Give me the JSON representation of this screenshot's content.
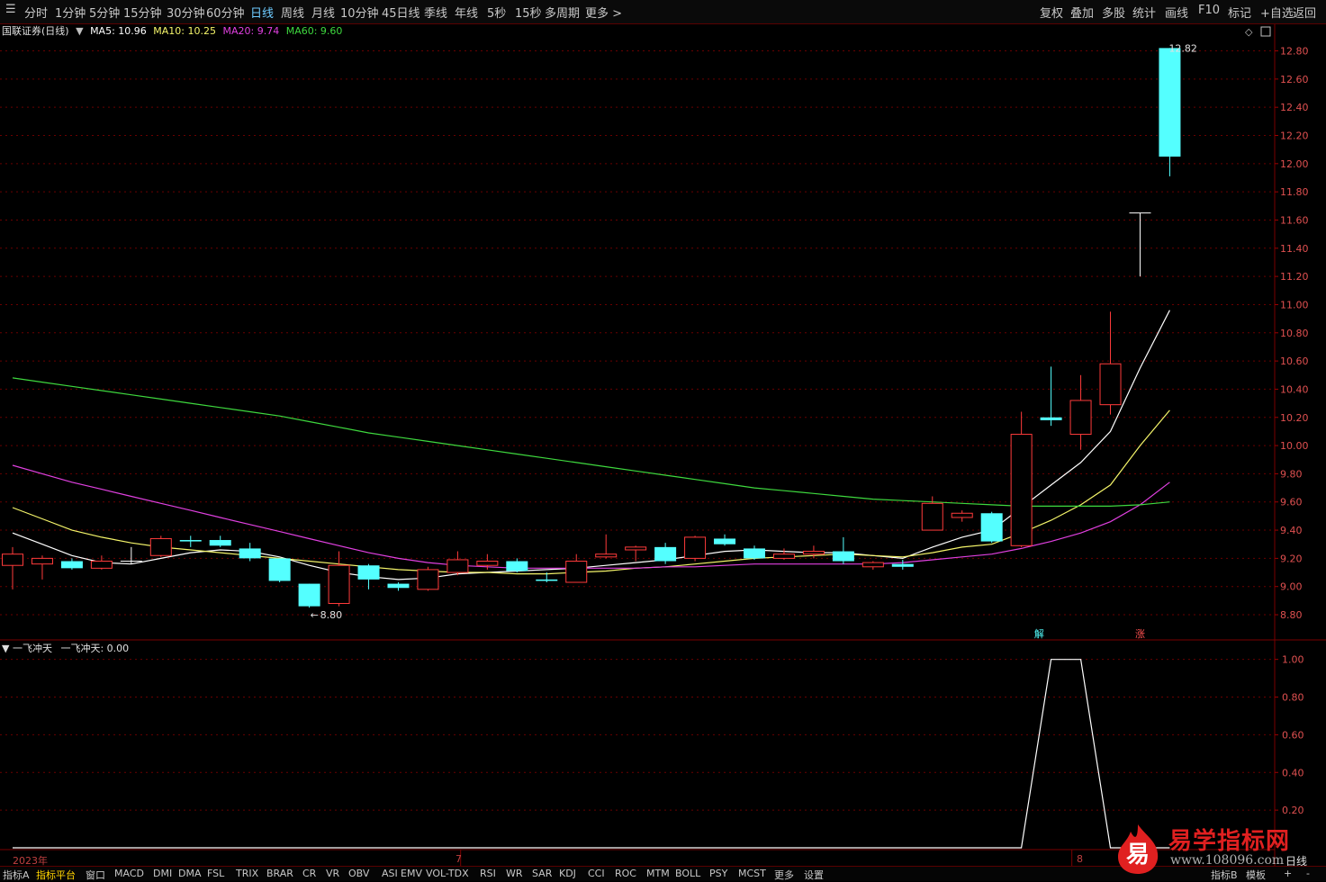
{
  "toolbar": {
    "left_items": [
      "分时",
      "1分钟",
      "5分钟",
      "15分钟",
      "30分钟",
      "60分钟",
      "日线",
      "周线",
      "月线",
      "10分钟",
      "45日线",
      "季线",
      "年线",
      "5秒",
      "15秒",
      "多周期",
      "更多 >"
    ],
    "active": "日线",
    "right_items": [
      "复权",
      "叠加",
      "多股",
      "统计",
      "画线",
      "F10",
      "标记",
      "+自选",
      "返回"
    ]
  },
  "legend": {
    "title": "国联证券(日线)",
    "ma5": "MA5: 10.96",
    "ma10": "MA10: 10.25",
    "ma20": "MA20: 9.74",
    "ma60": "MA60: 9.60"
  },
  "indicator": {
    "name": "一飞冲天",
    "value_label": "一飞冲天: 0.00"
  },
  "colors": {
    "up": "#ff3b3b",
    "down": "#54ffff",
    "ma5": "#ffffff",
    "ma10": "#f5f56a",
    "ma20": "#e040e0",
    "ma60": "#3ed83e",
    "grid": "#6a0000",
    "axis_text": "#e05050"
  },
  "chart_data": [
    {
      "type": "candlestick",
      "title": "国联证券(日线)",
      "y_ticks": [
        "12.80",
        "12.60",
        "12.40",
        "12.20",
        "12.00",
        "11.80",
        "11.60",
        "11.40",
        "11.20",
        "11.00",
        "10.80",
        "10.60",
        "10.40",
        "10.20",
        "10.00",
        "9.80",
        "9.60",
        "9.40",
        "9.20",
        "9.00",
        "8.80"
      ],
      "ylim": [
        8.73,
        12.88
      ],
      "annotations": {
        "high_label": "12.82",
        "low_label": "8.80",
        "marker_jie": "解",
        "marker_zhang": "涨"
      },
      "candles": [
        {
          "o": 9.15,
          "c": 9.23,
          "h": 9.28,
          "l": 8.98
        },
        {
          "o": 9.16,
          "c": 9.2,
          "h": 9.22,
          "l": 9.05
        },
        {
          "o": 9.18,
          "c": 9.13,
          "h": 9.2,
          "l": 9.12
        },
        {
          "o": 9.13,
          "c": 9.18,
          "h": 9.22,
          "l": 9.12
        },
        {
          "o": 9.18,
          "c": 9.18,
          "h": 9.28,
          "l": 9.16
        },
        {
          "o": 9.22,
          "c": 9.34,
          "h": 9.36,
          "l": 9.21
        },
        {
          "o": 9.33,
          "c": 9.32,
          "h": 9.36,
          "l": 9.28
        },
        {
          "o": 9.33,
          "c": 9.29,
          "h": 9.36,
          "l": 9.28
        },
        {
          "o": 9.27,
          "c": 9.2,
          "h": 9.31,
          "l": 9.18
        },
        {
          "o": 9.2,
          "c": 9.04,
          "h": 9.2,
          "l": 9.03
        },
        {
          "o": 9.02,
          "c": 8.86,
          "h": 9.02,
          "l": 8.85
        },
        {
          "o": 8.88,
          "c": 9.15,
          "h": 9.25,
          "l": 8.86
        },
        {
          "o": 9.15,
          "c": 9.05,
          "h": 9.16,
          "l": 8.98
        },
        {
          "o": 9.02,
          "c": 8.99,
          "h": 9.03,
          "l": 8.97
        },
        {
          "o": 8.98,
          "c": 9.12,
          "h": 9.14,
          "l": 8.97
        },
        {
          "o": 9.1,
          "c": 9.19,
          "h": 9.25,
          "l": 9.08
        },
        {
          "o": 9.15,
          "c": 9.18,
          "h": 9.23,
          "l": 9.12
        },
        {
          "o": 9.18,
          "c": 9.11,
          "h": 9.2,
          "l": 9.1
        },
        {
          "o": 9.05,
          "c": 9.04,
          "h": 9.1,
          "l": 9.03
        },
        {
          "o": 9.03,
          "c": 9.18,
          "h": 9.23,
          "l": 9.03
        },
        {
          "o": 9.21,
          "c": 9.23,
          "h": 9.37,
          "l": 9.2
        },
        {
          "o": 9.26,
          "c": 9.28,
          "h": 9.29,
          "l": 9.18
        },
        {
          "o": 9.28,
          "c": 9.18,
          "h": 9.31,
          "l": 9.16
        },
        {
          "o": 9.2,
          "c": 9.35,
          "h": 9.36,
          "l": 9.18
        },
        {
          "o": 9.34,
          "c": 9.3,
          "h": 9.37,
          "l": 9.29
        },
        {
          "o": 9.27,
          "c": 9.2,
          "h": 9.29,
          "l": 9.19
        },
        {
          "o": 9.2,
          "c": 9.23,
          "h": 9.27,
          "l": 9.19
        },
        {
          "o": 9.23,
          "c": 9.25,
          "h": 9.29,
          "l": 9.2
        },
        {
          "o": 9.25,
          "c": 9.18,
          "h": 9.35,
          "l": 9.16
        },
        {
          "o": 9.14,
          "c": 9.17,
          "h": 9.18,
          "l": 9.12
        },
        {
          "o": 9.16,
          "c": 9.14,
          "h": 9.19,
          "l": 9.12
        },
        {
          "o": 9.4,
          "c": 9.59,
          "h": 9.64,
          "l": 9.4
        },
        {
          "o": 9.49,
          "c": 9.52,
          "h": 9.54,
          "l": 9.46
        },
        {
          "o": 9.52,
          "c": 9.32,
          "h": 9.53,
          "l": 9.31
        },
        {
          "o": 9.29,
          "c": 10.08,
          "h": 10.24,
          "l": 9.28
        },
        {
          "o": 10.2,
          "c": 10.18,
          "h": 10.56,
          "l": 10.14
        },
        {
          "o": 10.08,
          "c": 10.32,
          "h": 10.5,
          "l": 9.97
        },
        {
          "o": 10.29,
          "c": 10.58,
          "h": 10.95,
          "l": 10.22
        },
        {
          "o": 11.65,
          "c": 11.65,
          "h": 11.65,
          "l": 11.2
        },
        {
          "o": 12.82,
          "c": 12.05,
          "h": 12.82,
          "l": 11.91
        }
      ],
      "series": [
        {
          "name": "MA5",
          "values": [
            9.38,
            9.3,
            9.22,
            9.17,
            9.16,
            9.2,
            9.24,
            9.26,
            9.25,
            9.21,
            9.15,
            9.1,
            9.07,
            9.05,
            9.06,
            9.09,
            9.1,
            9.11,
            9.12,
            9.13,
            9.15,
            9.17,
            9.19,
            9.22,
            9.25,
            9.26,
            9.25,
            9.24,
            9.24,
            9.22,
            9.2,
            9.28,
            9.35,
            9.4,
            9.56,
            9.72,
            9.88,
            10.1,
            10.55,
            10.96
          ]
        },
        {
          "name": "MA10",
          "values": [
            9.56,
            9.48,
            9.4,
            9.35,
            9.31,
            9.28,
            9.26,
            9.24,
            9.22,
            9.2,
            9.18,
            9.16,
            9.14,
            9.12,
            9.11,
            9.1,
            9.1,
            9.09,
            9.09,
            9.1,
            9.11,
            9.13,
            9.14,
            9.16,
            9.18,
            9.2,
            9.21,
            9.22,
            9.23,
            9.22,
            9.21,
            9.24,
            9.28,
            9.3,
            9.38,
            9.47,
            9.58,
            9.72,
            10.0,
            10.25
          ]
        },
        {
          "name": "MA20",
          "values": [
            9.86,
            9.8,
            9.74,
            9.69,
            9.64,
            9.59,
            9.54,
            9.49,
            9.44,
            9.39,
            9.34,
            9.29,
            9.24,
            9.2,
            9.17,
            9.15,
            9.14,
            9.13,
            9.13,
            9.13,
            9.13,
            9.13,
            9.14,
            9.14,
            9.15,
            9.16,
            9.16,
            9.16,
            9.16,
            9.16,
            9.17,
            9.19,
            9.21,
            9.23,
            9.27,
            9.32,
            9.38,
            9.46,
            9.58,
            9.74
          ]
        },
        {
          "name": "MA60",
          "values": [
            10.48,
            10.45,
            10.42,
            10.39,
            10.36,
            10.33,
            10.3,
            10.27,
            10.24,
            10.21,
            10.17,
            10.13,
            10.09,
            10.06,
            10.03,
            10.0,
            9.97,
            9.94,
            9.91,
            9.88,
            9.85,
            9.82,
            9.79,
            9.76,
            9.73,
            9.7,
            9.68,
            9.66,
            9.64,
            9.62,
            9.61,
            9.6,
            9.59,
            9.58,
            9.57,
            9.57,
            9.57,
            9.57,
            9.58,
            9.6
          ]
        }
      ]
    },
    {
      "type": "line",
      "title": "一飞冲天",
      "y_ticks": [
        "1.00",
        "0.80",
        "0.60",
        "0.40",
        "0.20"
      ],
      "ylim": [
        0,
        1.07
      ],
      "series": [
        {
          "name": "一飞冲天",
          "values": [
            0,
            0,
            0,
            0,
            0,
            0,
            0,
            0,
            0,
            0,
            0,
            0,
            0,
            0,
            0,
            0,
            0,
            0,
            0,
            0,
            0,
            0,
            0,
            0,
            0,
            0,
            0,
            0,
            0,
            0,
            0,
            0,
            0,
            0,
            0,
            1,
            1,
            0,
            0,
            0
          ]
        }
      ]
    }
  ],
  "xaxis": {
    "year": "2023年",
    "m7": "7",
    "m8": "8",
    "period": "日线"
  },
  "bottom_tabs": [
    "指标A",
    "指标平台",
    "窗口",
    "MACD",
    "DMI",
    "DMA",
    "FSL",
    "TRIX",
    "BRAR",
    "CR",
    "VR",
    "OBV",
    "ASI",
    "EMV",
    "VOL-TDX",
    "RSI",
    "WR",
    "SAR",
    "KDJ",
    "CCI",
    "ROC",
    "MTM",
    "BOLL",
    "PSY",
    "MCST",
    "更多",
    "设置"
  ],
  "bottom_active": "指标平台",
  "bottom_right": [
    "指标B",
    "模板",
    "+",
    "-"
  ],
  "logo": {
    "mark": "易",
    "text": "易学指标网",
    "url": "www.108096.com"
  }
}
